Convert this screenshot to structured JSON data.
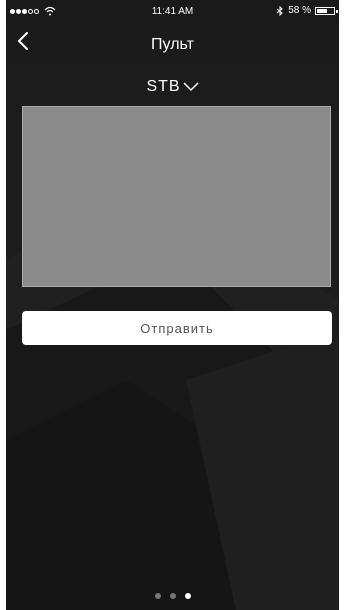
{
  "status_bar": {
    "time": "11:41 AM",
    "battery": "58 %"
  },
  "nav": {
    "title": "Пульт"
  },
  "device": {
    "selected": "STB"
  },
  "actions": {
    "send_label": "Отправить"
  },
  "pager": {
    "pages": 3,
    "active_index": 2
  },
  "colors": {
    "background": "#1d1d1d",
    "screen": "#8b8b8b",
    "button_bg": "#ffffff",
    "button_text": "#555555"
  }
}
